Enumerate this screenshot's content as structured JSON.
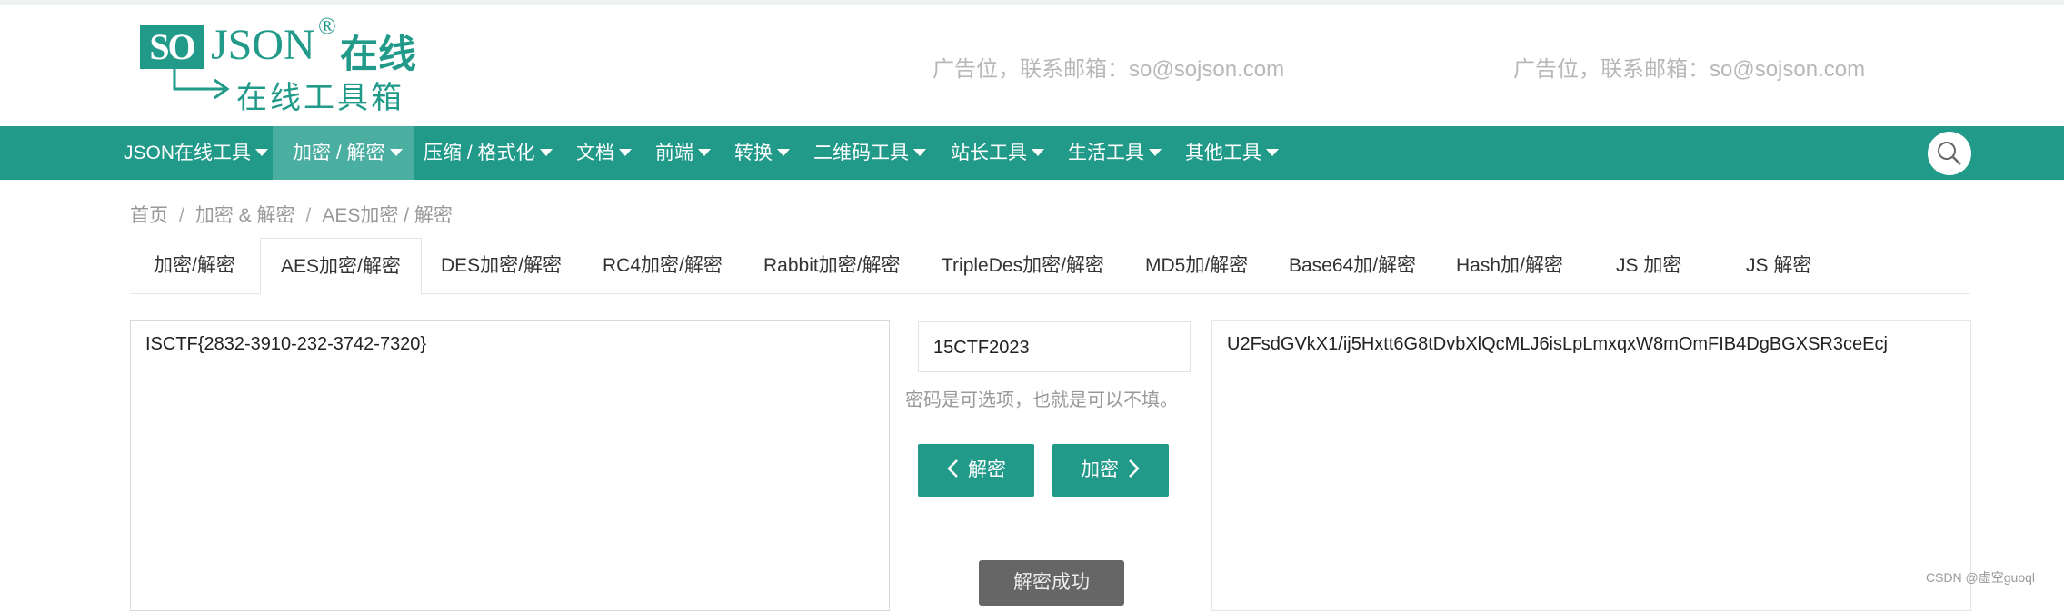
{
  "logo": {
    "box_text": "SO",
    "json_text": "JSON",
    "reg_mark": "®",
    "zaixian": "在线",
    "subtitle": "在线工具箱"
  },
  "ads": [
    "广告位，联系邮箱：so@sojson.com",
    "广告位，联系邮箱：so@sojson.com"
  ],
  "nav": {
    "items": [
      {
        "label": "JSON在线工具",
        "active": false
      },
      {
        "label": "加密 / 解密",
        "active": true
      },
      {
        "label": "压缩 / 格式化",
        "active": false
      },
      {
        "label": "文档",
        "active": false
      },
      {
        "label": "前端",
        "active": false
      },
      {
        "label": "转换",
        "active": false
      },
      {
        "label": "二维码工具",
        "active": false
      },
      {
        "label": "站长工具",
        "active": false
      },
      {
        "label": "生活工具",
        "active": false
      },
      {
        "label": "其他工具",
        "active": false
      }
    ],
    "search_icon": "search-icon"
  },
  "breadcrumb": [
    "首页",
    "加密 & 解密",
    "AES加密 / 解密"
  ],
  "breadcrumb_sep": "/",
  "tabs": [
    {
      "label": "加密/解密",
      "active": false
    },
    {
      "label": "AES加密/解密",
      "active": true
    },
    {
      "label": "DES加密/解密",
      "active": false
    },
    {
      "label": "RC4加密/解密",
      "active": false
    },
    {
      "label": "Rabbit加密/解密",
      "active": false
    },
    {
      "label": "TripleDes加密/解密",
      "active": false
    },
    {
      "label": "MD5加/解密",
      "active": false
    },
    {
      "label": "Base64加/解密",
      "active": false
    },
    {
      "label": "Hash加/解密",
      "active": false
    },
    {
      "label": "JS 加密",
      "active": false
    },
    {
      "label": "JS 解密",
      "active": false
    }
  ],
  "plaintext": "ISCTF{2832-3910-232-3742-7320}",
  "password": "15CTF2023",
  "password_hint": "密码是可选项，也就是可以不填。",
  "buttons": {
    "decrypt": "解密",
    "encrypt": "加密"
  },
  "ciphertext": "U2FsdGVkX1/ij5Hxtt6G8tDvbXlQcMLJ6isLpLmxqxW8mOmFIB4DgBGXSR3ceEcj",
  "toast": "解密成功",
  "watermark": "CSDN @虚空guoql",
  "colors": {
    "brand": "#229a8a",
    "nav_active": "#4aaea1"
  }
}
